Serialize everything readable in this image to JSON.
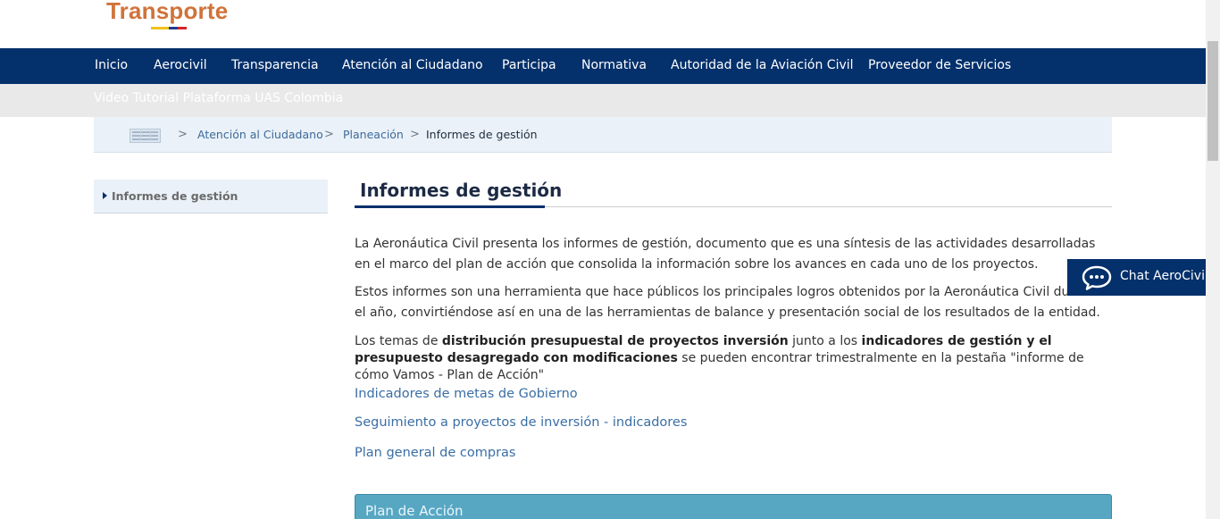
{
  "header": {
    "logo_text": "Transporte",
    "flag_colors": [
      "#f2c21b",
      "#1f3d8f",
      "#d8232a"
    ]
  },
  "nav": {
    "items": [
      "Inicio",
      "Aerocivil",
      "Transparencia",
      "Atención al Ciudadano",
      "Participa",
      "Normativa",
      "Autoridad de la Aviación Civil",
      "Proveedor de Servicios"
    ]
  },
  "subnav": {
    "link": "Video Tutorial Plataforma UAS Colombia"
  },
  "breadcrumb": {
    "home_icon": "home-icon",
    "separator": ">",
    "items": [
      "Atención al Ciudadano",
      "Planeación"
    ],
    "current": "Informes de gestión"
  },
  "sidebar": {
    "items": [
      "Informes de gestión"
    ]
  },
  "main": {
    "title": "Informes de gestión",
    "paragraph1": "La Aeronáutica Civil presenta los informes de gestión, documento que es una síntesis de las actividades desarrolladas en el marco del plan de acción que consolida la información sobre los avances en cada uno de los proyectos.",
    "paragraph2": "Estos informes son una herramienta que hace públicos los principales logros obtenidos por la Aeronáutica Civil durante el año, convirtiéndose así en una de las herramientas de balance y presentación social de los resultados de la entidad.",
    "paragraph3": {
      "part1": "Los temas de ",
      "bold1": "distribución presupuestal de proyectos inversión",
      "part2": " junto a los ",
      "bold2": "indicadores de gestión y el presupuesto desagregado con modificaciones",
      "part3": " se pueden encontrar trimestralmente en la pestaña  \"informe de cómo Vamos - Plan de Acción\""
    },
    "links": [
      "Indicadores de metas de Gobierno",
      "Seguimiento a proyectos de inversión - indicadores",
      "Plan general de compras"
    ],
    "accordion": {
      "label": "Plan de Acción"
    }
  },
  "chat": {
    "label": "Chat AeroCivil",
    "icon": "chat-bubble-icon"
  },
  "colors": {
    "nav_bg": "#04306b",
    "accent_orange": "#d0733a",
    "link_blue": "#3a6ea5",
    "accordion_bg": "#57a7c3"
  }
}
